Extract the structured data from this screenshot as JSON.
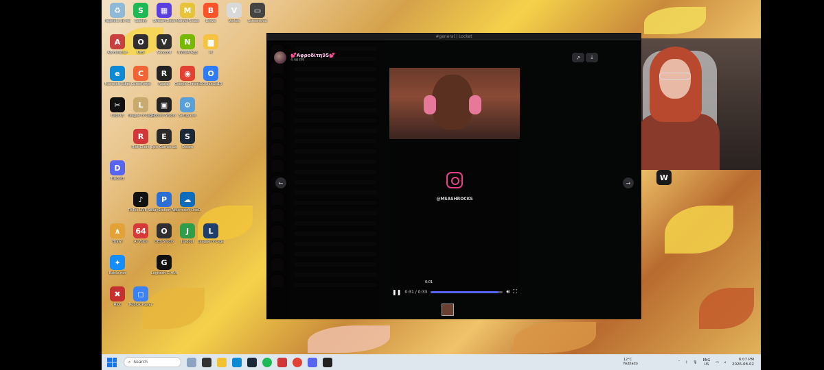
{
  "desktop": {
    "icons": [
      {
        "label": "Papelera de reciclaje",
        "color": "#8fb9d9",
        "glyph": "♻",
        "col": 0,
        "row": 0
      },
      {
        "label": "Spotify",
        "color": "#1db954",
        "glyph": "S",
        "col": 1,
        "row": 0
      },
      {
        "label": "Stream Deck",
        "color": "#5a3fe0",
        "glyph": "▦",
        "col": 2,
        "row": 0
      },
      {
        "label": "Marvel Rivals",
        "color": "#e7c33a",
        "glyph": "M",
        "col": 3,
        "row": 0
      },
      {
        "label": "Brave",
        "color": "#fb542b",
        "glyph": "B",
        "col": 4,
        "row": 0
      },
      {
        "label": "Vortex",
        "color": "#d9d9d9",
        "glyph": "V",
        "col": 5,
        "row": 0
      },
      {
        "label": "Screenshot",
        "color": "#444",
        "glyph": "▭",
        "col": 6,
        "row": 0
      },
      {
        "label": "Administrar",
        "color": "#c94040",
        "glyph": "A",
        "col": 0,
        "row": 1
      },
      {
        "label": "OBS",
        "color": "#302e31",
        "glyph": "O",
        "col": 1,
        "row": 1
      },
      {
        "label": "Vencord",
        "color": "#2f2f2f",
        "glyph": "V",
        "col": 2,
        "row": 1
      },
      {
        "label": "NVIDIA App",
        "color": "#76b900",
        "glyph": "N",
        "col": 3,
        "row": 1
      },
      {
        "label": "M",
        "color": "#f5c242",
        "glyph": "▆",
        "col": 4,
        "row": 1
      },
      {
        "label": "Microsoft Edge",
        "color": "#0c8ad6",
        "glyph": "e",
        "col": 0,
        "row": 2
      },
      {
        "label": "CurseForge",
        "color": "#f16436",
        "glyph": "C",
        "col": 1,
        "row": 2
      },
      {
        "label": "Raptor",
        "color": "#222",
        "glyph": "R",
        "col": 2,
        "row": 2
      },
      {
        "label": "Google Chrome",
        "color": "#e34133",
        "glyph": "◉",
        "col": 3,
        "row": 2
      },
      {
        "label": "OOShutUp10",
        "color": "#2f7cf6",
        "glyph": "O",
        "col": 4,
        "row": 2
      },
      {
        "label": "CapCut",
        "color": "#111",
        "glyph": "✂",
        "col": 0,
        "row": 3
      },
      {
        "label": "League of Legends",
        "color": "#c8aa6e",
        "glyph": "L",
        "col": 1,
        "row": 3
      },
      {
        "label": "Roblox Studio",
        "color": "#222",
        "glyph": "▣",
        "col": 2,
        "row": 3
      },
      {
        "label": "Setup.exe",
        "color": "#5aa0d8",
        "glyph": "⚙",
        "col": 3,
        "row": 3
      },
      {
        "label": "Epic Games Launcher",
        "color": "#2a2a2a",
        "glyph": "E",
        "col": 2,
        "row": 4
      },
      {
        "label": "Steam",
        "color": "#1b2838",
        "glyph": "S",
        "col": 3,
        "row": 4
      },
      {
        "label": "Riot Client",
        "color": "#d13639",
        "glyph": "R",
        "col": 1,
        "row": 4
      },
      {
        "label": "Discord",
        "color": "#5865f2",
        "glyph": "D",
        "col": 0,
        "row": 5
      },
      {
        "label": "TikTok LIVE Studio",
        "color": "#111",
        "glyph": "♪",
        "col": 1,
        "row": 6
      },
      {
        "label": "PlayStation Accessories",
        "color": "#2b6fd6",
        "glyph": "P",
        "col": 2,
        "row": 6
      },
      {
        "label": "Microsoft OneDrive",
        "color": "#0f6cbd",
        "glyph": "☁",
        "col": 3,
        "row": 6
      },
      {
        "label": "Brawl",
        "color": "#e3a237",
        "glyph": "∧",
        "col": 0,
        "row": 7
      },
      {
        "label": "AI Voice",
        "color": "#d83a3a",
        "glyph": "64",
        "col": 1,
        "row": 7
      },
      {
        "label": "OBS Studio",
        "color": "#302e31",
        "glyph": "O",
        "col": 2,
        "row": 7
      },
      {
        "label": "Jusdoul",
        "color": "#2e9e4a",
        "glyph": "J",
        "col": 3,
        "row": 7
      },
      {
        "label": "League of Legends PBE",
        "color": "#1e3f6b",
        "glyph": "L",
        "col": 4,
        "row": 7
      },
      {
        "label": "Battle.net",
        "color": "#148eff",
        "glyph": "✦",
        "col": 0,
        "row": 8
      },
      {
        "label": "Logitech G HUB",
        "color": "#111",
        "glyph": "G",
        "col": 2,
        "row": 8
      },
      {
        "label": "Roblox Player",
        "color": "#3b82f6",
        "glyph": "◻",
        "col": 1,
        "row": 9
      },
      {
        "label": "Riot",
        "color": "#c53030",
        "glyph": "✖",
        "col": 0,
        "row": 9
      }
    ]
  },
  "discord": {
    "window_title": "#general | Locket",
    "user": {
      "name": "💕Αφροδίτη95💕",
      "time": "4:48 PM"
    },
    "video": {
      "insta_handle": "@MSASHROCKS",
      "current_time": "0:31",
      "duration": "0:33",
      "seek_tooltip": "0:01",
      "progress": 0.94
    }
  },
  "taskbar": {
    "search_placeholder": "Search",
    "weather_temp": "12°C",
    "weather_desc": "Nublado",
    "lang1": "ENG",
    "lang2": "US",
    "time": "6:07 PM",
    "date": "2026-08-02"
  }
}
